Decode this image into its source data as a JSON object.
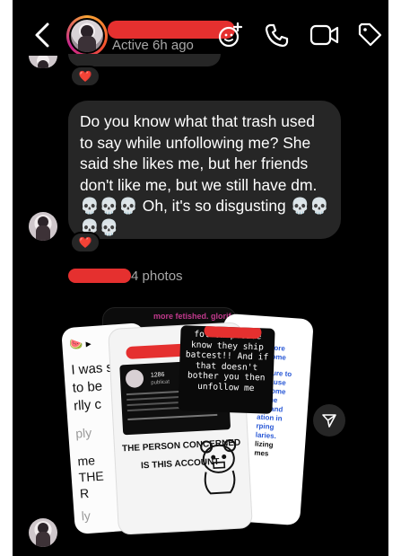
{
  "header": {
    "status": "Active 6h ago",
    "icons": [
      "back-icon",
      "effects-icon",
      "call-icon",
      "video-icon",
      "tag-icon"
    ]
  },
  "message": {
    "text": "Do you know what that trash used to say while unfollowing me? She said she likes me, but her friends don't like me, but we still have dm. 💀💀💀 Oh, it's so disgusting 💀💀💀💀",
    "reaction": "❤️"
  },
  "photos": {
    "label": "4 photos",
    "left_texts": [
      "I was s",
      "to be",
      "rlly c",
      "ply",
      "me",
      "THE",
      "R",
      "ly"
    ],
    "top_text": "more fetished. glorif",
    "right_texts": [
      "y more",
      "n some",
      "essure to",
      "n cause",
      "become",
      "to the",
      "ost and",
      "ation in",
      "rping",
      "laries.",
      "lizing",
      "mes"
    ],
    "black_text": "follow please know they ship batcest!! And if that doesn't bother you then unfollow me",
    "profile_stats": "1286",
    "profile_label": "publicat",
    "caption_1": "THE PERSON CONCERNED",
    "caption_2": "IS THIS ACCOUNT"
  },
  "colors": {
    "background": "#000000",
    "bubble": "#262626",
    "redaction": "#e5302f",
    "secondary_text": "#a8a8a8"
  }
}
